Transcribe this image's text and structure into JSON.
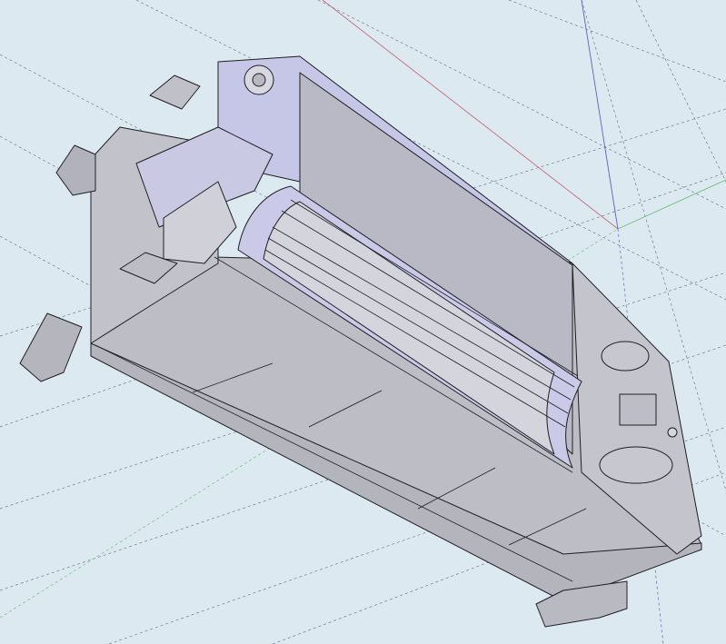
{
  "viewport": {
    "background": "#dde9f1",
    "axes": {
      "red": "#c46a78",
      "green": "#6fbf7a",
      "blue": "#5a63c8"
    },
    "guide_color": "#6a7f8f",
    "model": {
      "name": "duct-fan-coil-unit-section",
      "face_colors": {
        "light": "#cfcfd6",
        "mid": "#b7b7c0",
        "dark": "#9e9eaa",
        "blue_tint": "#c7c7ea",
        "edge": "#1e1e24"
      }
    }
  }
}
